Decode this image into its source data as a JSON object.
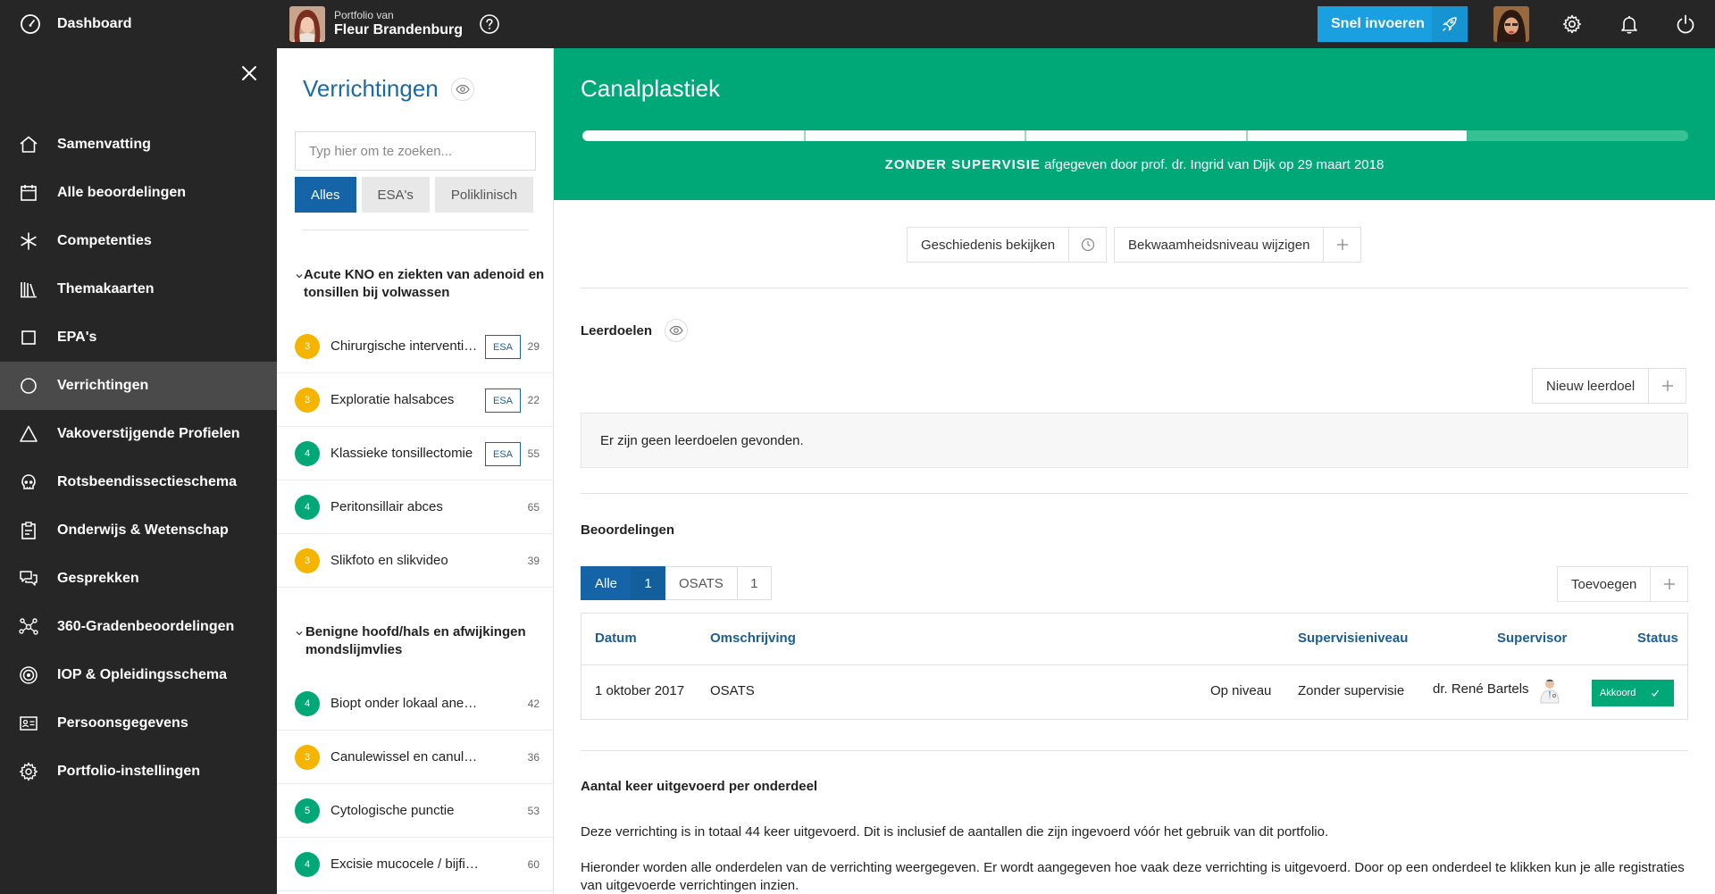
{
  "topbar": {
    "dashboard_label": "Dashboard",
    "portfolio_small": "Portfolio van",
    "portfolio_name": "Fleur Brandenburg",
    "snel_label": "Snel invoeren",
    "icons": [
      "dashboard-icon",
      "help-icon",
      "rocket-icon",
      "gear-icon",
      "bell-icon",
      "power-icon"
    ]
  },
  "sidebar": {
    "items": [
      {
        "label": "Samenvatting",
        "icon": "home-icon"
      },
      {
        "label": "Alle beoordelingen",
        "icon": "calendar-icon"
      },
      {
        "label": "Competenties",
        "icon": "asterisk-icon"
      },
      {
        "label": "Themakaarten",
        "icon": "books-icon"
      },
      {
        "label": "EPA's",
        "icon": "square-icon"
      },
      {
        "label": "Verrichtingen",
        "icon": "circle-icon",
        "active": true
      },
      {
        "label": "Vakoverstijgende Profielen",
        "icon": "triangle-icon"
      },
      {
        "label": "Rotsbeendissectieschema",
        "icon": "skull-icon"
      },
      {
        "label": "Onderwijs & Wetenschap",
        "icon": "clipboard-icon"
      },
      {
        "label": "Gesprekken",
        "icon": "chat-icon"
      },
      {
        "label": "360-Gradenbeoordelingen",
        "icon": "network-icon"
      },
      {
        "label": "IOP & Opleidingsschema",
        "icon": "target-icon"
      },
      {
        "label": "Persoonsgegevens",
        "icon": "id-card-icon"
      },
      {
        "label": "Portfolio-instellingen",
        "icon": "gear-icon"
      }
    ]
  },
  "middle": {
    "title": "Verrichtingen",
    "search_placeholder": "Typ hier om te zoeken...",
    "filters": [
      "Alles",
      "ESA's",
      "Poliklinisch"
    ],
    "groups": [
      {
        "title": "Acute KNO en ziekten van adenoid en tonsillen bij volwassen",
        "items": [
          {
            "level": "3",
            "name": "Chirurgische interventie bij",
            "esa": "ESA",
            "count": "29"
          },
          {
            "level": "3",
            "name": "Exploratie halsabces",
            "esa": "ESA",
            "count": "22"
          },
          {
            "level": "4",
            "name": "Klassieke tonsillectomie",
            "esa": "ESA",
            "count": "55"
          },
          {
            "level": "4",
            "name": "Peritonsillair abces",
            "esa": "",
            "count": "65"
          },
          {
            "level": "3",
            "name": "Slikfoto en slikvideo",
            "esa": "",
            "count": "39"
          }
        ]
      },
      {
        "title": "Benigne hoofd/hals en afwijkingen mondslijmvlies",
        "items": [
          {
            "level": "4",
            "name": "Biopt onder lokaal aneasthesie",
            "esa": "",
            "count": "42"
          },
          {
            "level": "3",
            "name": "Canulewissel en canulezorg",
            "esa": "",
            "count": "36"
          },
          {
            "level": "5",
            "name": "Cytologische punctie",
            "esa": "",
            "count": "53"
          },
          {
            "level": "4",
            "name": "Excisie mucocele / bijfibroom",
            "esa": "",
            "count": "60"
          }
        ]
      }
    ],
    "level_colors": {
      "3": "#f5b400",
      "4": "#00a878",
      "5": "#00a878"
    }
  },
  "main": {
    "title": "Canalplastiek",
    "progress": 0.8,
    "progress_segments": 5,
    "supervision_level": "ZONDER SUPERVISIE",
    "supervision_rest": "afgegeven door prof. dr. Ingrid van Dijk op 29 maart 2018",
    "history_label": "Geschiedenis bekijken",
    "change_level_label": "Bekwaamheidsniveau wijzigen",
    "leerdoelen": {
      "title": "Leerdoelen",
      "new_label": "Nieuw leerdoel",
      "empty_text": "Er zijn geen leerdoelen gevonden."
    },
    "beoordelingen": {
      "title": "Beoordelingen",
      "tabs": [
        {
          "label": "Alle",
          "count": "1"
        },
        {
          "label": "OSATS",
          "count": "1"
        }
      ],
      "add_label": "Toevoegen",
      "columns": [
        "Datum",
        "Omschrijving",
        "Supervisieniveau",
        "Supervisor",
        "Status"
      ],
      "rows": [
        {
          "date": "1 oktober 2017",
          "description": "OSATS",
          "level": "Op niveau",
          "supervision": "Zonder supervisie",
          "supervisor": "dr. René Bartels",
          "status": "Akkoord"
        }
      ]
    },
    "aantal": {
      "title": "Aantal keer uitgevoerd per onderdeel",
      "p1": "Deze verrichting is in totaal 44 keer uitgevoerd. Dit is inclusief de aantallen die zijn ingevoerd vóór het gebruik van dit portfolio.",
      "p2": "Hieronder worden alle onderdelen van de verrichting weergegeven. Er wordt aangegeven hoe vaak deze verrichting is uitgevoerd. Door op een onderdeel te klikken kun je alle registraties van uitgevoerde verrichtingen inzien."
    },
    "colors": {
      "accent_green": "#00a878",
      "accent_blue": "#1564a8",
      "snel_blue": "#1a9fe0",
      "dark": "#262626"
    }
  }
}
